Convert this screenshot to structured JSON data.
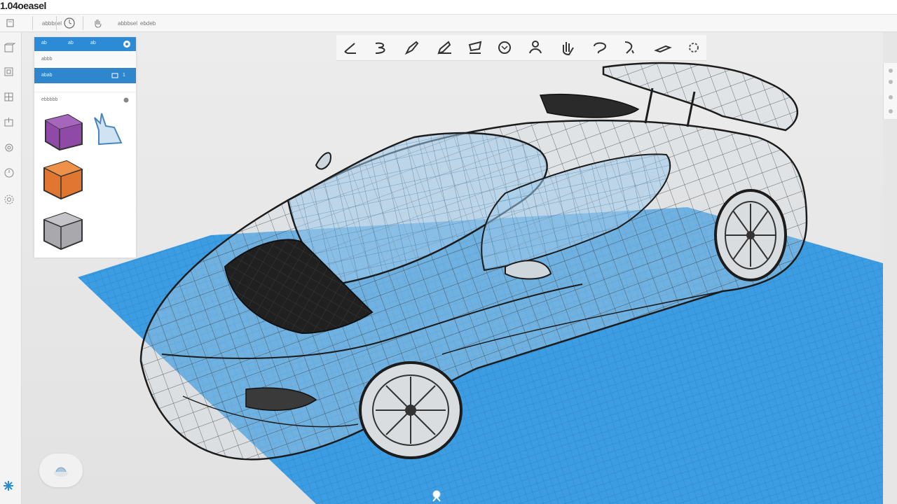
{
  "app": {
    "title": "1.04oeasel"
  },
  "toolbar": {
    "items": [
      {
        "icon": "document-icon"
      },
      {
        "icon": "clock-icon"
      },
      {
        "icon": "hand-icon"
      },
      {
        "label": "ebdeb"
      }
    ],
    "small_label_1": "abbbsel"
  },
  "left_rail": {
    "icons": [
      "cube-outline-icon",
      "layers-icon",
      "grid-icon",
      "export-icon",
      "settings-icon",
      "history-icon",
      "gear-icon"
    ]
  },
  "shape_panel": {
    "header_tabs": [
      "ab",
      "ab",
      "ab"
    ],
    "row1_label": "abbb",
    "row2_label": "abab",
    "row2_badge": "1",
    "section_title": "ebbbbb",
    "shapes": [
      {
        "name": "box",
        "color": "#8e4aa6"
      },
      {
        "name": "rabbit",
        "color": "#7fb5e0"
      },
      {
        "name": "orange-box",
        "color": "#e07630"
      },
      {
        "name": "gray-box",
        "color": "#a8a8ad"
      }
    ]
  },
  "tool_strip": {
    "tools": [
      "pen-icon",
      "spline-icon",
      "brush-icon",
      "pencil-icon",
      "edit-icon",
      "rotate-icon",
      "person-icon",
      "hand-icon",
      "lasso-icon",
      "measure-icon",
      "knife-icon",
      "settings-icon"
    ]
  },
  "colors": {
    "accent": "#2b8bd6",
    "grid": "#3a9be0",
    "grid_line": "#2b80c6",
    "wire": "#222222"
  }
}
